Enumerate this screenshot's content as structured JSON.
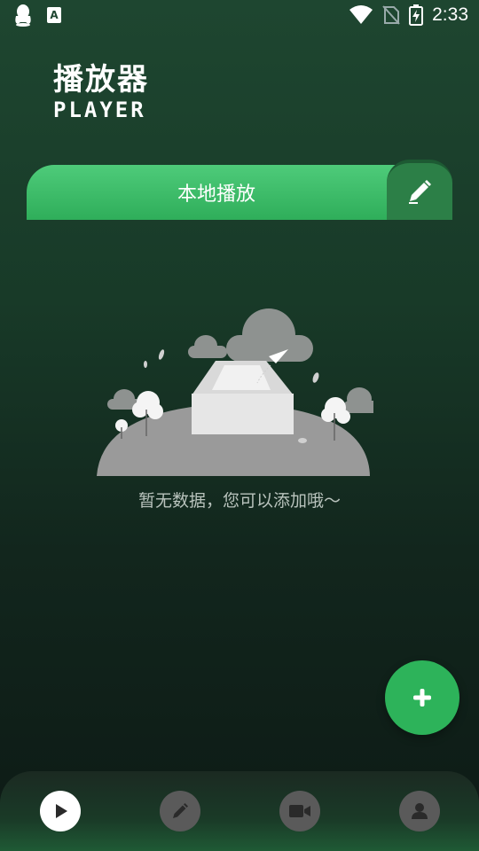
{
  "status_bar": {
    "time": "2:33",
    "icons": [
      "qq-icon",
      "font-app-icon",
      "wifi-icon",
      "no-sim-icon",
      "battery-charging-icon"
    ]
  },
  "header": {
    "title_cn": "播放器",
    "title_en": "PLAYER"
  },
  "local_play": {
    "label": "本地播放",
    "edit_icon": "pencil-icon"
  },
  "empty_state": {
    "message": "暂无数据，您可以添加哦～"
  },
  "fab": {
    "icon": "plus-icon"
  },
  "bottom_nav": {
    "items": [
      {
        "icon": "play-icon",
        "active": true
      },
      {
        "icon": "pencil-icon",
        "active": false
      },
      {
        "icon": "video-camera-icon",
        "active": false
      },
      {
        "icon": "user-icon",
        "active": false
      }
    ]
  },
  "colors": {
    "accent": "#2db35a",
    "background_top": "#1e4630",
    "background_bottom": "#0d1a15"
  }
}
